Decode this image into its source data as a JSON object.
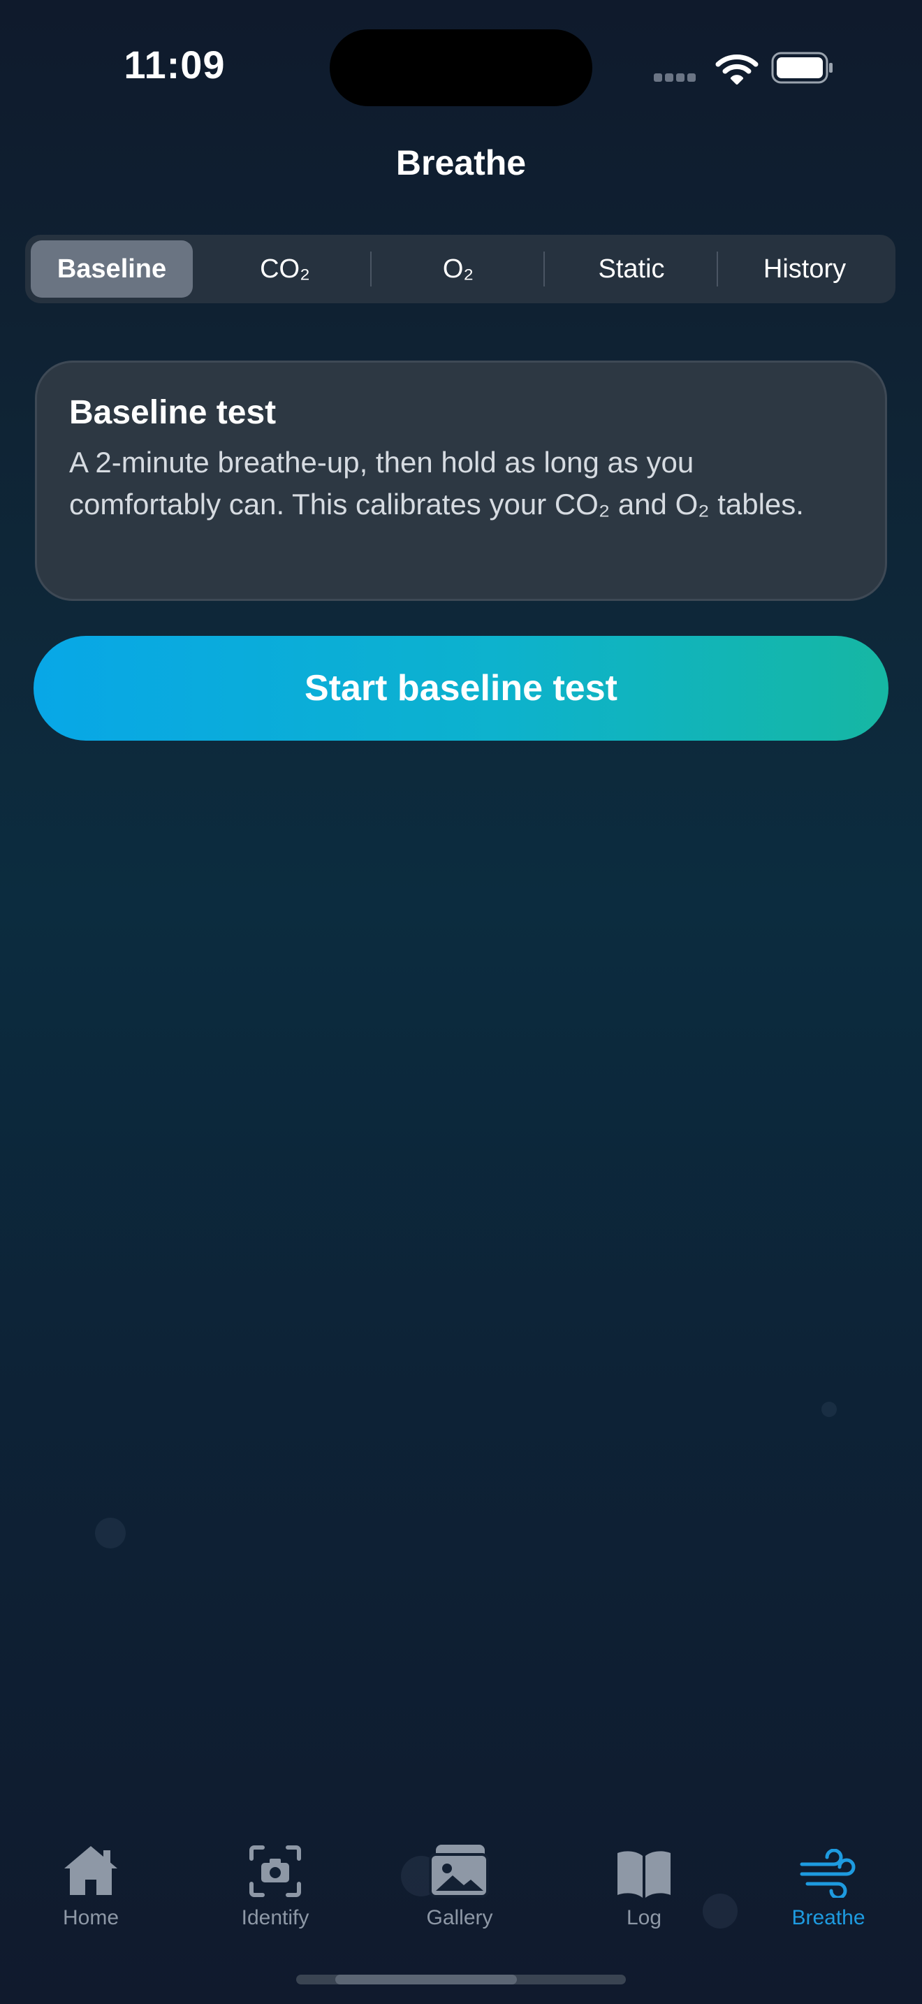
{
  "status_bar": {
    "time": "11:09"
  },
  "nav": {
    "title": "Breathe"
  },
  "segments": [
    {
      "label": "Baseline",
      "selected": true
    },
    {
      "label": "CO₂",
      "selected": false
    },
    {
      "label": "O₂",
      "selected": false
    },
    {
      "label": "Static",
      "selected": false
    },
    {
      "label": "History",
      "selected": false
    }
  ],
  "card": {
    "title": "Baseline test",
    "body": "A 2-minute breathe-up, then hold as long as you comfortably can. This calibrates your CO₂ and O₂ tables."
  },
  "start_button": {
    "label": "Start baseline test"
  },
  "tabs": [
    {
      "label": "Home",
      "icon": "house-icon"
    },
    {
      "label": "Identify",
      "icon": "camera-viewfinder-icon"
    },
    {
      "label": "Gallery",
      "icon": "photos-icon"
    },
    {
      "label": "Log",
      "icon": "book-icon"
    },
    {
      "label": "Breathe",
      "icon": "wind-icon",
      "active": true
    }
  ],
  "colors": {
    "accent": "#1e9be0",
    "button_gradient_start": "#08a7e7",
    "button_gradient_end": "#16b7a3",
    "inactive_tab": "#8e98a6"
  }
}
